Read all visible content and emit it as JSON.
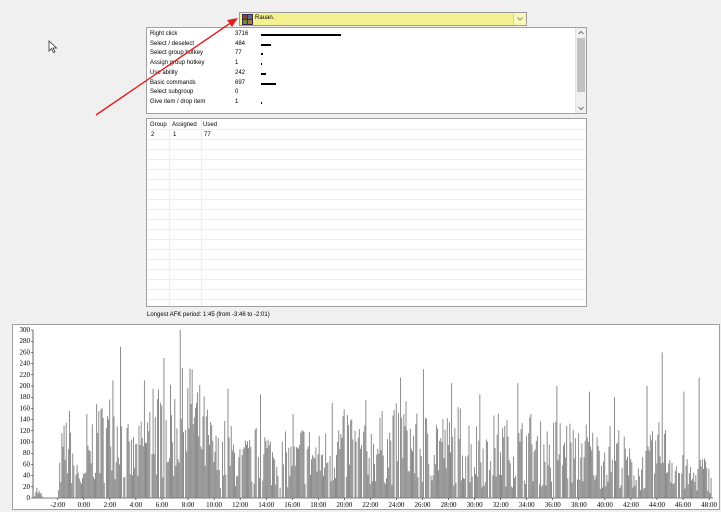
{
  "player": {
    "name": "Rauan."
  },
  "actions": [
    {
      "label": "Right click",
      "value": "3716",
      "count": 3716
    },
    {
      "label": "Select / deselect",
      "value": "484",
      "count": 484
    },
    {
      "label": "Select group hotkey",
      "value": "77",
      "count": 77
    },
    {
      "label": "Assign group hotkey",
      "value": "1",
      "count": 1
    },
    {
      "label": "Use ability",
      "value": "242",
      "count": 242
    },
    {
      "label": "Basic commands",
      "value": "697",
      "count": 697
    },
    {
      "label": "Select subgroup",
      "value": "0",
      "count": 0
    },
    {
      "label": "Give item / drop item",
      "value": "1",
      "count": 1
    }
  ],
  "groups": {
    "headers": [
      "Group",
      "Assigned",
      "Used"
    ],
    "rows": [
      [
        "2",
        "1",
        "77"
      ]
    ]
  },
  "afk": {
    "text": "Longest AFK period: 1:45 (from -3:46 to -2:01)"
  },
  "colors": {
    "selector": "#f5f090",
    "bars": "#808080",
    "arrow": "#e02020"
  },
  "chart_data": {
    "type": "bar",
    "x_ticks": [
      "-2:00",
      "0:00",
      "2:00",
      "4:00",
      "6:00",
      "8:00",
      "10:00",
      "12:00",
      "14:00",
      "16:00",
      "18:00",
      "20:00",
      "22:00",
      "24:00",
      "26:00",
      "28:00",
      "30:00",
      "32:00",
      "34:00",
      "36:00",
      "38:00",
      "40:00",
      "42:00",
      "44:00",
      "46:00",
      "48:00"
    ],
    "y_ticks": [
      0,
      20,
      40,
      60,
      80,
      100,
      120,
      140,
      160,
      180,
      200,
      220,
      240,
      260,
      280,
      300
    ],
    "ylim": [
      0,
      300
    ],
    "xlim_minutes": [
      -3.9,
      48.3
    ],
    "profile": [
      [
        -3.75,
        20
      ],
      [
        -3.1,
        0
      ],
      [
        -2.0,
        0
      ],
      [
        -1.8,
        80
      ],
      [
        -1.2,
        120
      ],
      [
        -0.6,
        60
      ],
      [
        0.0,
        30
      ],
      [
        0.6,
        110
      ],
      [
        1.2,
        120
      ],
      [
        1.8,
        130
      ],
      [
        2.4,
        150
      ],
      [
        3.0,
        110
      ],
      [
        3.6,
        80
      ],
      [
        4.2,
        90
      ],
      [
        4.8,
        130
      ],
      [
        5.4,
        140
      ],
      [
        6.0,
        150
      ],
      [
        6.6,
        140
      ],
      [
        7.2,
        150
      ],
      [
        7.8,
        170
      ],
      [
        8.4,
        160
      ],
      [
        9.0,
        140
      ],
      [
        9.6,
        110
      ],
      [
        10.2,
        80
      ],
      [
        10.8,
        100
      ],
      [
        11.4,
        90
      ],
      [
        12.0,
        70
      ],
      [
        12.6,
        80
      ],
      [
        13.2,
        90
      ],
      [
        13.8,
        100
      ],
      [
        14.4,
        80
      ],
      [
        15.0,
        90
      ],
      [
        15.6,
        80
      ],
      [
        16.2,
        70
      ],
      [
        16.8,
        100
      ],
      [
        17.4,
        90
      ],
      [
        18.0,
        80
      ],
      [
        18.6,
        90
      ],
      [
        19.2,
        100
      ],
      [
        19.8,
        110
      ],
      [
        20.4,
        120
      ],
      [
        21.0,
        100
      ],
      [
        21.6,
        90
      ],
      [
        22.2,
        100
      ],
      [
        22.8,
        110
      ],
      [
        23.4,
        100
      ],
      [
        24.0,
        120
      ],
      [
        24.6,
        130
      ],
      [
        25.2,
        110
      ],
      [
        25.8,
        100
      ],
      [
        26.4,
        110
      ],
      [
        27.0,
        120
      ],
      [
        27.6,
        110
      ],
      [
        28.2,
        100
      ],
      [
        28.8,
        120
      ],
      [
        29.4,
        110
      ],
      [
        30.0,
        100
      ],
      [
        30.6,
        90
      ],
      [
        31.2,
        100
      ],
      [
        31.8,
        110
      ],
      [
        32.4,
        100
      ],
      [
        33.0,
        90
      ],
      [
        33.6,
        100
      ],
      [
        34.2,
        110
      ],
      [
        34.8,
        100
      ],
      [
        35.4,
        90
      ],
      [
        36.0,
        100
      ],
      [
        36.6,
        110
      ],
      [
        37.2,
        100
      ],
      [
        37.8,
        90
      ],
      [
        38.4,
        100
      ],
      [
        39.0,
        90
      ],
      [
        39.6,
        80
      ],
      [
        40.2,
        90
      ],
      [
        40.8,
        100
      ],
      [
        41.4,
        80
      ],
      [
        42.0,
        60
      ],
      [
        42.6,
        50
      ],
      [
        43.2,
        70
      ],
      [
        43.8,
        90
      ],
      [
        44.4,
        100
      ],
      [
        45.0,
        80
      ],
      [
        45.6,
        60
      ],
      [
        46.2,
        50
      ],
      [
        46.8,
        40
      ],
      [
        47.4,
        60
      ],
      [
        48.0,
        40
      ]
    ],
    "peaks": [
      [
        0.2,
        150
      ],
      [
        1.1,
        155
      ],
      [
        2.2,
        210
      ],
      [
        2.8,
        270
      ],
      [
        4.6,
        210
      ],
      [
        5.3,
        195
      ],
      [
        6.1,
        250
      ],
      [
        7.4,
        300
      ],
      [
        8.3,
        230
      ],
      [
        11.0,
        195
      ],
      [
        13.5,
        185
      ],
      [
        16.0,
        150
      ],
      [
        19.0,
        170
      ],
      [
        21.6,
        175
      ],
      [
        24.3,
        215
      ],
      [
        25.7,
        200
      ],
      [
        26.0,
        230
      ],
      [
        28.2,
        205
      ],
      [
        30.4,
        185
      ],
      [
        33.3,
        205
      ],
      [
        36.3,
        200
      ],
      [
        38.8,
        190
      ],
      [
        40.7,
        180
      ],
      [
        43.2,
        200
      ],
      [
        44.4,
        260
      ],
      [
        46.0,
        190
      ],
      [
        47.2,
        215
      ]
    ]
  }
}
